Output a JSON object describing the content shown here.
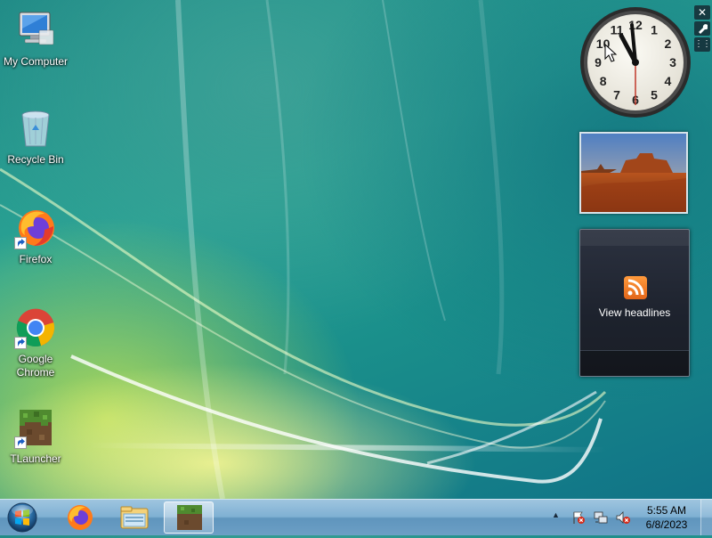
{
  "desktop": {
    "icons": [
      {
        "label": "My Computer"
      },
      {
        "label": "Recycle Bin"
      },
      {
        "label": "Firefox"
      },
      {
        "label": "Google Chrome"
      },
      {
        "label": "TLauncher"
      }
    ]
  },
  "gadgets": {
    "controls": {
      "close": "✕",
      "options": "🔧",
      "drag": "⋮⋮"
    },
    "clock": {
      "numbers": [
        "12",
        "1",
        "2",
        "3",
        "4",
        "5",
        "6",
        "7",
        "8",
        "9",
        "10",
        "11"
      ]
    },
    "feed": {
      "label": "View headlines"
    }
  },
  "taskbar": {
    "pinned": [
      "firefox-icon",
      "explorer-icon",
      "tlauncher-icon"
    ],
    "tray": {
      "time": "5:55 AM",
      "date": "6/8/2023",
      "show_hidden": "▲"
    }
  }
}
